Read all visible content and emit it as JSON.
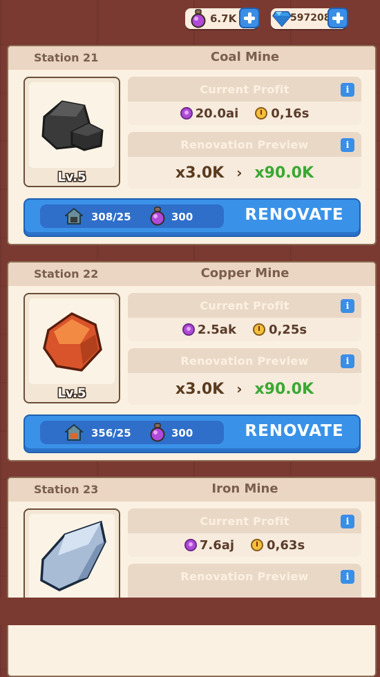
{
  "currencies": {
    "potion": {
      "value": "6.7K",
      "icon": "potion-icon"
    },
    "gems": {
      "value": "597208",
      "icon": "diamond-icon"
    }
  },
  "labels": {
    "current_profit": "Current Profit",
    "renovation_preview": "Renovation Preview",
    "renovate_button": "RENOVATE",
    "info": "i"
  },
  "stations": [
    {
      "station": "Station 21",
      "name": "Coal Mine",
      "level": "Lv.5",
      "profit": "20.0ai",
      "time": "0,16s",
      "mult_old": "x3.0K",
      "mult_new": "x90.0K",
      "requirement": "308/25",
      "cost": "300",
      "ore_color": "#3a3a3a"
    },
    {
      "station": "Station 22",
      "name": "Copper Mine",
      "level": "Lv.5",
      "profit": "2.5ak",
      "time": "0,25s",
      "mult_old": "x3.0K",
      "mult_new": "x90.0K",
      "requirement": "356/25",
      "cost": "300",
      "ore_color": "#e0662a"
    },
    {
      "station": "Station 23",
      "name": "Iron Mine",
      "level": "",
      "profit": "7.6aj",
      "time": "0,63s",
      "mult_old": "",
      "mult_new": "",
      "requirement": "",
      "cost": "",
      "ore_color": "#a8bcd6"
    }
  ]
}
